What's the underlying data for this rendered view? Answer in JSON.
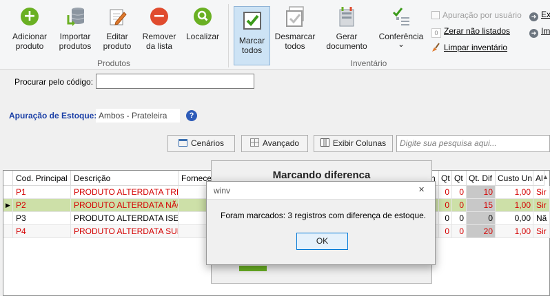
{
  "ribbon": {
    "produtos_group": "Produtos",
    "inventario_group": "Inventário",
    "buttons": {
      "adicionar": "Adicionar produto",
      "importar": "Importar produtos",
      "editar": "Editar produto",
      "remover": "Remover da lista",
      "localizar": "Localizar",
      "marcar": "Marcar todos",
      "desmarcar": "Desmarcar todos",
      "gerar": "Gerar documento",
      "conferencia": "Conferência",
      "conferencia_arrow": "⌄"
    },
    "small": {
      "apuracao_usuario": "Apuração por usuário",
      "zerar": "Zerar não listados",
      "limpar": "Limpar inventário",
      "ex": "Ex",
      "im": "Im"
    },
    "colors": {
      "green": "#6ab023",
      "red": "#e04b2e",
      "accent": "#cde3f5"
    }
  },
  "search": {
    "codigo_label": "Procurar pelo código:",
    "codigo_value": "",
    "apuracao_label": "Apuração de Estoque:",
    "apuracao_value": "Ambos - Prateleira",
    "cenarios": "Cenários",
    "avancado": "Avançado",
    "exibir_colunas": "Exibir Colunas",
    "pesquisa_placeholder": "Digite sua pesquisa aqui..."
  },
  "grid": {
    "headers": [
      "Cod. Principal",
      "Descrição",
      "Fornece",
      "n",
      "Qt",
      "Qt",
      "Qt. Dif",
      "Custo Un",
      "Al"
    ],
    "rows": [
      {
        "cod": "P1",
        "desc": "PRODUTO ALTERDATA TRIBU",
        "qt1": "0",
        "qt2": "0",
        "dif": "10",
        "custo": "1,00",
        "al": "Sir",
        "style": "red"
      },
      {
        "cod": "P2",
        "desc": "PRODUTO ALTERDATA NÃO",
        "qt1": "0",
        "qt2": "0",
        "dif": "15",
        "custo": "1,00",
        "al": "Sir",
        "style": "red-selected"
      },
      {
        "cod": "P3",
        "desc": "PRODUTO ALTERDATA ISENT",
        "qt1": "0",
        "qt2": "0",
        "dif": "0",
        "custo": "0,00",
        "al": "Nã",
        "style": "normal"
      },
      {
        "cod": "P4",
        "desc": "PRODUTO ALTERDATA SUBST",
        "qt1": "0",
        "qt2": "0",
        "dif": "20",
        "custo": "1,00",
        "al": "Sir",
        "style": "red"
      }
    ]
  },
  "progress_dialog": {
    "title": "Marcando diferenca"
  },
  "message_box": {
    "title": "winv",
    "close": "✕",
    "message": "Foram marcados: 3 registros com diferença de estoque.",
    "ok": "OK"
  }
}
